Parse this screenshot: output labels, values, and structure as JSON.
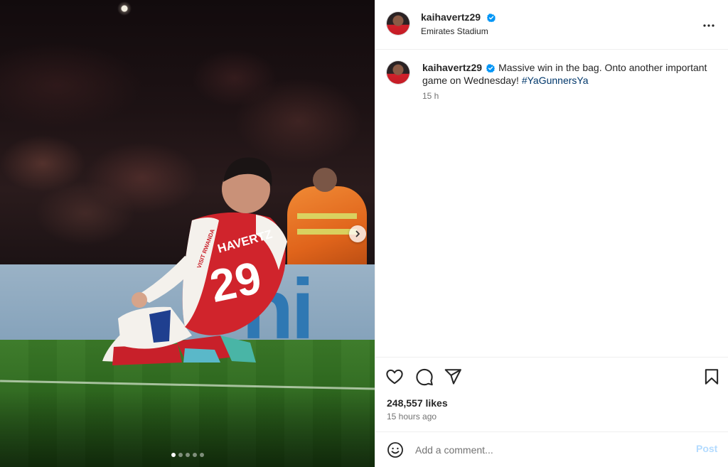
{
  "post": {
    "author": "kaihavertz29",
    "location": "Emirates Stadium",
    "caption_text": "Massive win in the bag. Onto another important game on Wednesday!",
    "hashtag": "#YaGunnersYa",
    "caption_time": "15 h",
    "likes": "248,557 likes",
    "posted_ago": "15 hours ago"
  },
  "media": {
    "jersey_name": "HAVERTZ",
    "jersey_number": "29",
    "sponsor": "VISIT RWANDA",
    "ad_board_text": "hi",
    "carousel_count": 5,
    "carousel_index": 0
  },
  "comment": {
    "placeholder": "Add a comment...",
    "post_label": "Post"
  },
  "icons": {
    "verified": "verified-badge-icon",
    "more": "more-options-icon",
    "like": "heart-icon",
    "comment": "comment-icon",
    "share": "share-icon",
    "save": "bookmark-icon",
    "emoji": "smiley-icon",
    "next": "chevron-right-icon"
  },
  "colors": {
    "verified_blue": "#0095f6",
    "hashtag": "#00376b",
    "post_disabled": "#b3dbff"
  }
}
